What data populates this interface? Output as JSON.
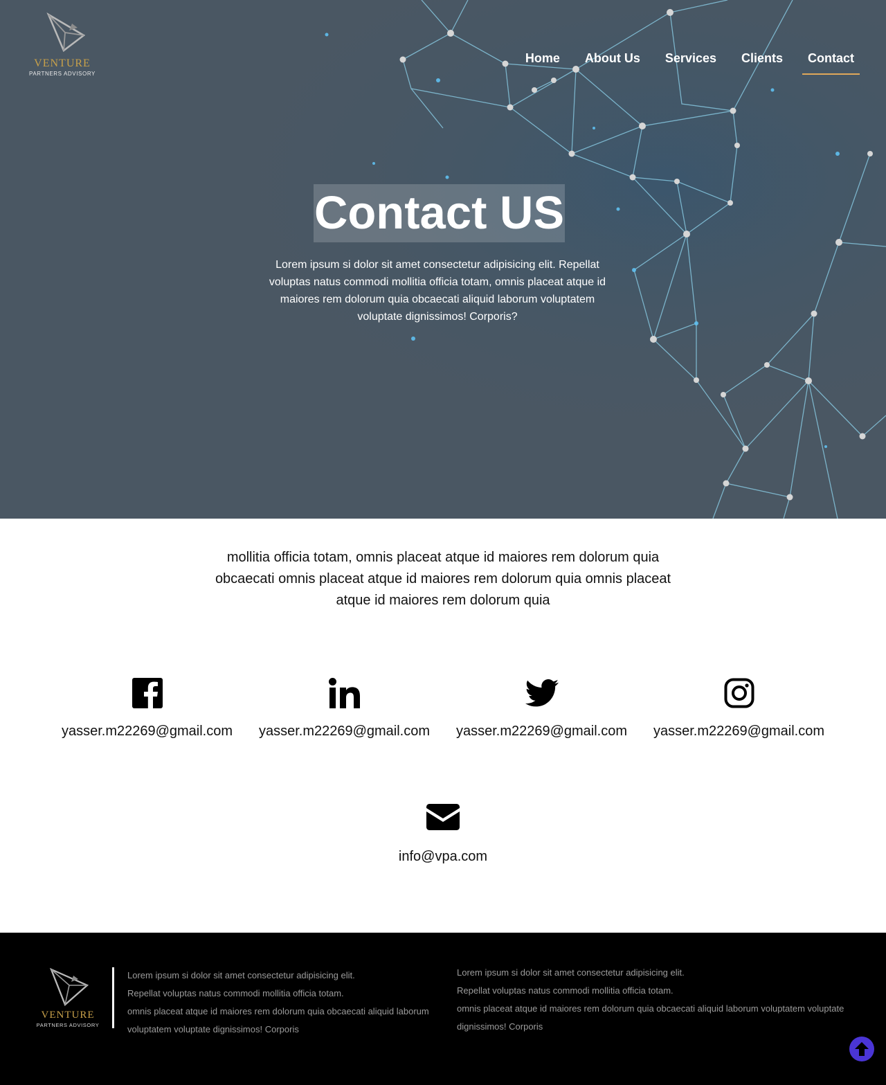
{
  "brand": {
    "name": "VENTURE",
    "tagline": "PARTNERS ADVISORY",
    "logo_icon": "triangle-logo-icon",
    "accent_color": "#c8a14a"
  },
  "nav": {
    "items": [
      {
        "label": "Home"
      },
      {
        "label": "About Us"
      },
      {
        "label": "Services"
      },
      {
        "label": "Clients"
      },
      {
        "label": "Contact"
      }
    ],
    "active": "Contact",
    "active_underline_color": "#e0a85a"
  },
  "hero": {
    "title": "Contact US",
    "text": "Lorem ipsum si dolor sit amet consectetur adipisicing elit. Repellat voluptas natus commodi mollitia officia totam, omnis placeat atque id maiores rem dolorum quia obcaecati aliquid laborum voluptatem voluptate dignissimos! Corporis?",
    "background_color": "#4a5763"
  },
  "intro": {
    "text": "mollitia officia totam, omnis placeat atque id maiores rem dolorum quia obcaecati omnis placeat atque id maiores rem dolorum quia omnis placeat atque id maiores rem dolorum quia"
  },
  "socials": [
    {
      "icon": "facebook-icon",
      "text": "yasser.m22269@gmail.com"
    },
    {
      "icon": "linkedin-icon",
      "text": "yasser.m22269@gmail.com"
    },
    {
      "icon": "twitter-icon",
      "text": "yasser.m22269@gmail.com"
    },
    {
      "icon": "instagram-icon",
      "text": "yasser.m22269@gmail.com"
    }
  ],
  "email": {
    "icon": "envelope-icon",
    "text": "info@vpa.com"
  },
  "footer": {
    "col1": [
      "Lorem ipsum si dolor sit amet consectetur adipisicing elit.",
      "Repellat voluptas natus commodi mollitia officia totam.",
      "omnis placeat atque id maiores rem dolorum quia obcaecati aliquid laborum",
      "voluptatem voluptate dignissimos! Corporis"
    ],
    "col2": [
      "Lorem ipsum si dolor sit amet consectetur adipisicing elit.",
      "Repellat voluptas natus commodi mollitia officia totam.",
      "omnis placeat atque id maiores rem dolorum quia obcaecati aliquid laborum voluptatem voluptate dignissimos! Corporis"
    ],
    "background_color": "#000000"
  },
  "scroll_top": {
    "icon": "arrow-up-icon",
    "color": "#4a35d6"
  }
}
